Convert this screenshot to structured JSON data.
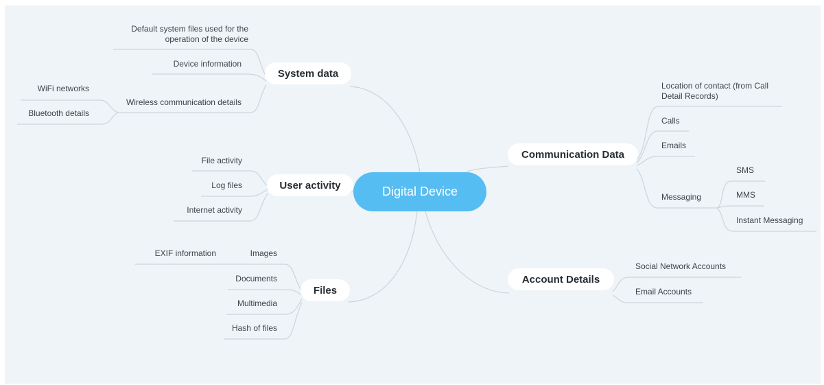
{
  "root": "Digital Device",
  "branches": {
    "system_data": {
      "label": "System data",
      "items": [
        "Default system files used for the operation of the device",
        "Device information",
        "Wireless communication details"
      ],
      "wireless_children": [
        "WiFi networks",
        "Bluetooth details"
      ]
    },
    "user_activity": {
      "label": "User activity",
      "items": [
        "File activity",
        "Log files",
        "Internet activity"
      ]
    },
    "files": {
      "label": "Files",
      "items": [
        "Images",
        "Documents",
        "Multimedia",
        "Hash of files"
      ],
      "images_children": [
        "EXIF information"
      ]
    },
    "communication_data": {
      "label": "Communication Data",
      "items": [
        "Location of contact (from Call Detail Records)",
        "Calls",
        "Emails",
        "Messaging"
      ],
      "messaging_children": [
        "SMS",
        "MMS",
        "Instant Messaging"
      ]
    },
    "account_details": {
      "label": "Account Details",
      "items": [
        "Social Network Accounts",
        "Email Accounts"
      ]
    }
  },
  "colors": {
    "root_fill": "#55bdf1",
    "background": "#eef4f7",
    "connector": "#ccd5dc",
    "branch_fill": "#ffffff"
  }
}
